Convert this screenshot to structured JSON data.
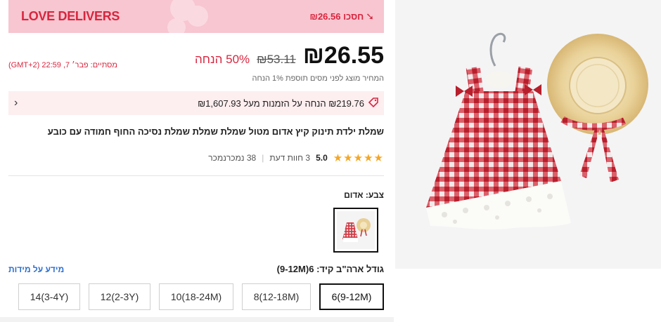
{
  "promo": {
    "logo_text": "LOVE DELIVERS",
    "save_text": "חסכו ₪26.56"
  },
  "price": {
    "current": "₪26.55",
    "original": "₪53.11",
    "discount": "50% הנחה",
    "tax_note": "המחיר מוצג לפני מסים תוספת 1% הנחה",
    "countdown": "מסתיים:  פבר׳ 7, 22:59 (GMT+2)"
  },
  "coupon": {
    "text": "₪219.76 הנחה על הזמנות מעל ₪1,607.93"
  },
  "product": {
    "title": "שמלת ילדת תינוק קיץ אדום מטול שמלת שמלת שמלת נסיכה החוף חמודה עם כובע",
    "rating_score": "5.0",
    "reviews": "3 חוות דעת",
    "sold": "38 נמכרנמכר"
  },
  "color": {
    "label": "צבע: אדום"
  },
  "size": {
    "label": "גודל ארה\"ב קיד: 6(9-12M)",
    "info_link": "מידע על מידות",
    "options": [
      "6(9-12M)",
      "8(12-18M)",
      "10(18-24M)",
      "12(2-3Y)",
      "14(3-4Y)"
    ],
    "selected": "6(9-12M)"
  },
  "colors": {
    "accent": "#d9253e",
    "promo_bg": "#f7c6d0",
    "coupon_bg": "#fdeef0",
    "link": "#2c6fd1",
    "stars": "#f5a623"
  }
}
